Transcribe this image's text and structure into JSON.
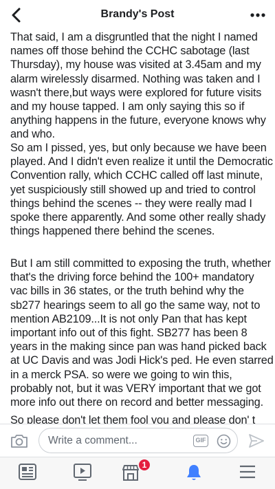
{
  "header": {
    "title": "Brandy's Post",
    "back_icon": "chevron-left-icon",
    "more_icon": "more-horizontal-icon"
  },
  "post": {
    "paragraphs": [
      {
        "lines": [
          "That said, I am a disgruntled that the night I named",
          "names off those behind the CCHC sabotage (last",
          "Thursday), my house was visited at 3.45am and my",
          "alarm wirelessly disarmed. Nothing was taken and I",
          "wasn't there,but ways were explored for future visits",
          "and my house tapped. I am only saying this so if",
          "anything happens in the future, everyone knows why",
          "and who."
        ]
      },
      {
        "lines": [
          "So am I pissed, yes, but only because we have been",
          "played. And I didn't even realize it until the Democratic",
          "Convention rally, which CCHC called off last minute,",
          "yet suspiciously still showed up and tried to control",
          "things behind the scenes -- they were really mad I",
          "spoke there apparently. And some other really shady",
          "things happened there behind the scenes."
        ]
      },
      {
        "lines": [
          "But I am still committed to exposing the truth, whether",
          "that's the driving force behind the 100+ mandatory",
          "vac bills in 36 states, or the truth behind why the",
          "sb277 hearings seem to all go the same way, not to",
          "mention AB2109...It is not only Pan that has kept",
          "important info out of this fight. SB277 has been 8",
          "years in the making since pan was hand picked back",
          "at UC Davis and was Jodi Hick's ped. He even starred",
          "in a merck PSA. so were we going to win this,",
          "probably not, but it was VERY important that we got",
          "more info out there on record and better messaging."
        ]
      },
      {
        "lines": [
          "So please don't let them fool you and please don' t"
        ]
      }
    ]
  },
  "comment_bar": {
    "camera_icon": "camera-icon",
    "placeholder": "Write a comment...",
    "gif_label": "GIF",
    "emoji_icon": "emoji-icon",
    "send_icon": "send-icon"
  },
  "tabbar": {
    "tabs": [
      {
        "name": "news-feed",
        "icon": "news-feed-icon"
      },
      {
        "name": "watch",
        "icon": "video-play-icon"
      },
      {
        "name": "marketplace",
        "icon": "marketplace-icon",
        "badge": "1"
      },
      {
        "name": "notifications",
        "icon": "bell-icon",
        "active": true
      },
      {
        "name": "menu",
        "icon": "hamburger-menu-icon"
      }
    ]
  },
  "colors": {
    "active_tab": "#4080ff",
    "icon_gray": "#606770",
    "badge": "#e41e3f",
    "text": "#1c1e21"
  }
}
